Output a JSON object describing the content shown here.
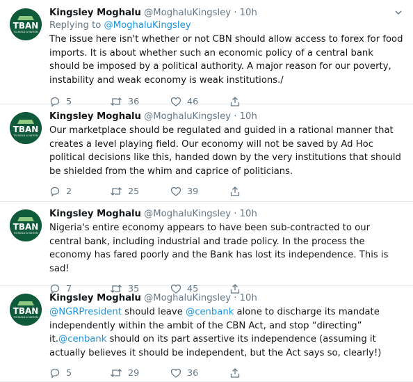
{
  "tweets": [
    {
      "name": "Kingsley Moghalu",
      "handle": "@MoghaluKingsley",
      "dot": "·",
      "time": "10h",
      "replying_prefix": "Replying to ",
      "replying_handle": "@MoghaluKingsley",
      "text": "The issue here isn't whether or not CBN should allow access to forex for food imports. It is about whether such an economic policy of a central bank should be imposed by a political authority. A major reason for our poverty, instability and weak economy is weak institutions./",
      "replies": "5",
      "retweets": "36",
      "likes": "46"
    },
    {
      "name": "Kingsley Moghalu",
      "handle": "@MoghaluKingsley",
      "dot": "·",
      "time": "10h",
      "text": "Our marketplace should be regulated and guided in a rational manner that creates a level playing field. Our economy will not be saved by Ad Hoc political decisions like this, handed down by the very institutions that should be shielded from the whim and caprice of politicians.",
      "replies": "2",
      "retweets": "25",
      "likes": "39"
    },
    {
      "name": "Kingsley Moghalu",
      "handle": "@MoghaluKingsley",
      "dot": "·",
      "time": "10h",
      "text": "Nigeria's entire economy appears to have been sub-contracted to our central bank, including industrial and trade policy. In the process the economy has fared poorly and the Bank has lost its independence. This is sad!",
      "replies": "7",
      "retweets": "35",
      "likes": "45"
    },
    {
      "name": "Kingsley Moghalu",
      "handle": "@MoghaluKingsley",
      "dot": "·",
      "time": "10h",
      "text_parts": {
        "m1": "@NGRPresident",
        "t1": " should leave ",
        "m2": "@cenbank",
        "t2": " alone to discharge its mandate independently within the ambit of the CBN Act, and stop “directing” it.",
        "m3": "@cenbank",
        "t3": " should on its part assertive its independence (assuming it actually believes it should be independent, but the Act says so, clearly!)"
      },
      "replies": "5",
      "retweets": "29",
      "likes": "36"
    }
  ],
  "avatar": {
    "logo_text": "TBAN",
    "tagline": "TO BUILD A NATION",
    "bg": "#0e5a3a",
    "fg": "#ffffff"
  },
  "colors": {
    "name": "#14171a",
    "muted": "#657786",
    "link": "#1b95e0",
    "divider": "#e6ecf0"
  },
  "icons": {
    "reply": "reply-icon",
    "retweet": "retweet-icon",
    "like": "like-icon",
    "share": "share-icon",
    "caret": "chevron-down-icon"
  }
}
